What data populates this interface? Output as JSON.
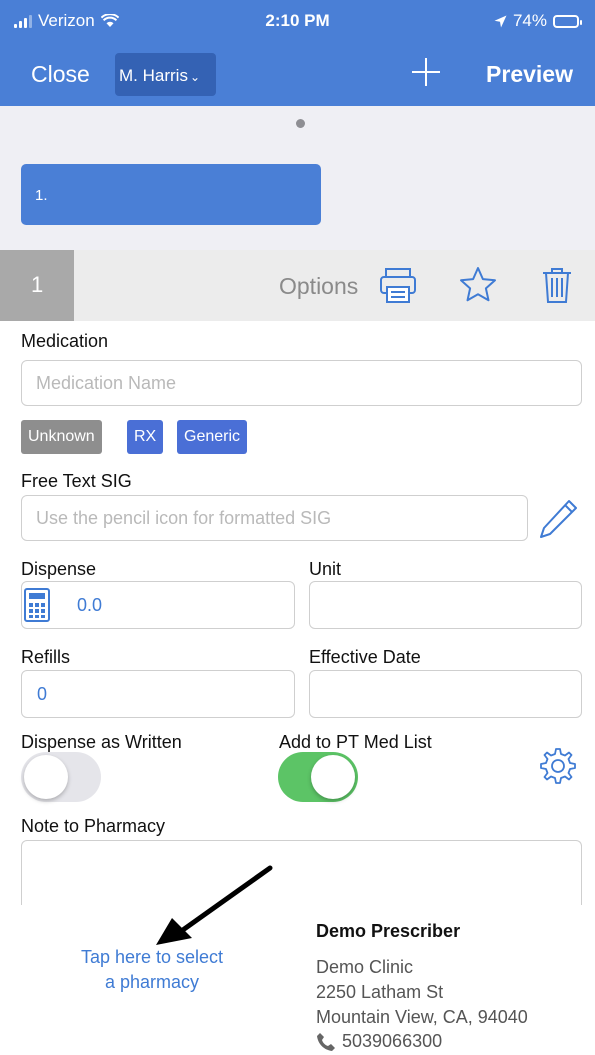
{
  "status_bar": {
    "carrier": "Verizon",
    "time": "2:10 PM",
    "battery": "74%",
    "battery_level": 0.74
  },
  "nav": {
    "close_label": "Close",
    "user_label": "M. Harris",
    "add_icon": "plus-icon",
    "preview_label": "Preview"
  },
  "prescription_tab": {
    "label": "1."
  },
  "options_row": {
    "number": "1",
    "options_label": "Options",
    "icons": [
      "printer-icon",
      "star-icon",
      "trash-icon"
    ]
  },
  "form": {
    "medication": {
      "label": "Medication",
      "placeholder": "Medication Name"
    },
    "chips": [
      {
        "label": "Unknown",
        "color": "#8e8e8e"
      },
      {
        "label": "RX",
        "color": "#4a6fd6"
      },
      {
        "label": "Generic",
        "color": "#4a6fd6"
      }
    ],
    "sig": {
      "label": "Free Text SIG",
      "placeholder": "Use the pencil icon for formatted SIG"
    },
    "dispense": {
      "label": "Dispense",
      "value": "0.0"
    },
    "unit": {
      "label": "Unit",
      "value": ""
    },
    "refills": {
      "label": "Refills",
      "value": "0"
    },
    "effective_date": {
      "label": "Effective Date",
      "value": ""
    },
    "dispense_as_written": {
      "label": "Dispense as Written",
      "on": false
    },
    "add_to_pt_med_list": {
      "label": "Add to PT Med List",
      "on": true
    },
    "note_to_pharmacy": {
      "label": "Note to Pharmacy",
      "value": ""
    }
  },
  "footer": {
    "pharmacy_link_line1": "Tap here to select",
    "pharmacy_link_line2": "a pharmacy",
    "prescriber_name": "Demo Prescriber",
    "clinic": "Demo Clinic",
    "address1": "2250 Latham St",
    "address2": "Mountain View, CA, 94040",
    "phone": "5039066300"
  },
  "colors": {
    "brand_blue": "#4a7fd6",
    "toggle_on": "#5cc466",
    "toggle_off": "#e5e5ea",
    "link_blue": "#3f7bd4"
  }
}
